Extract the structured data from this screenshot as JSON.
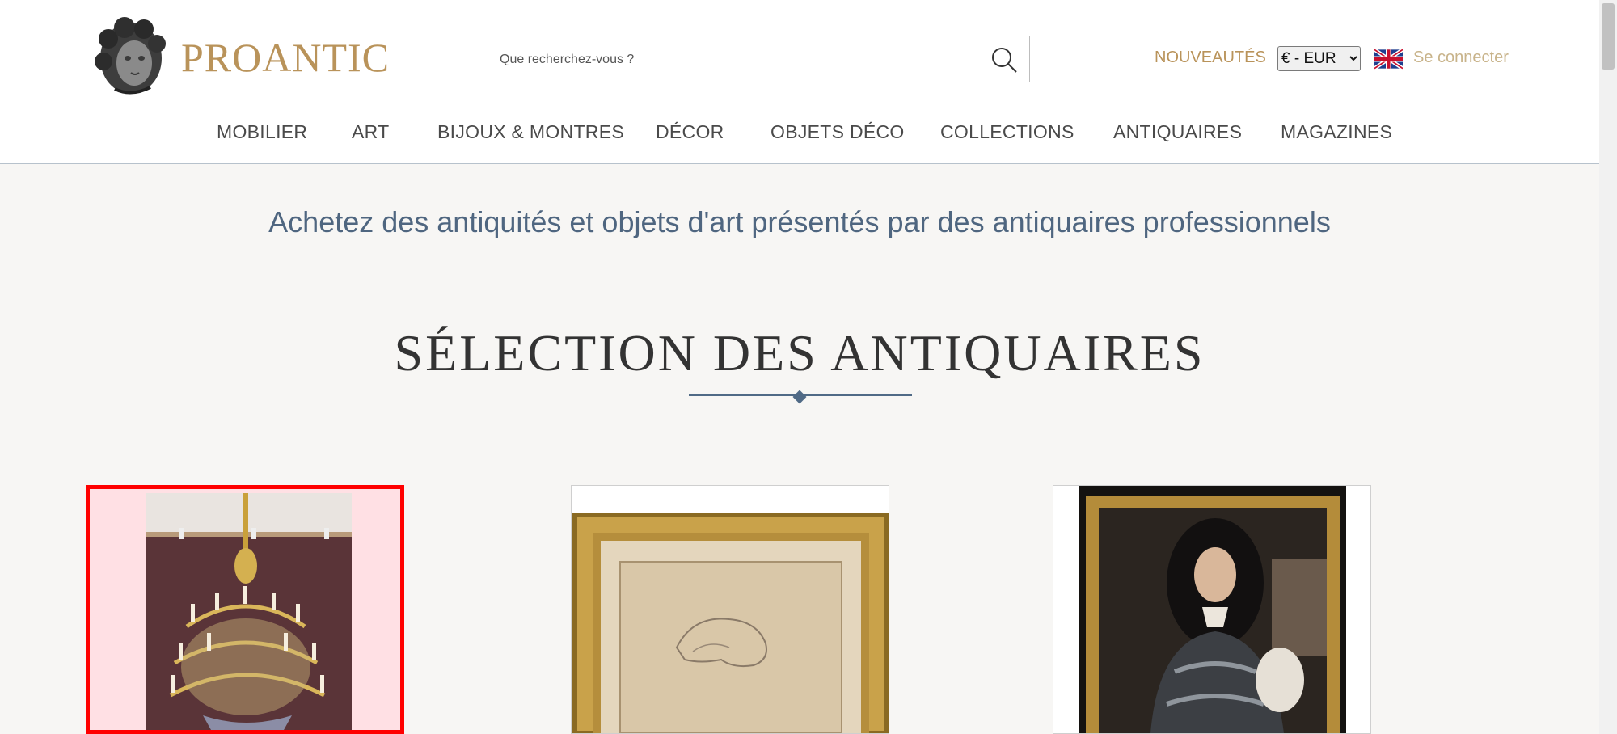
{
  "header": {
    "brand": "PROANTIC",
    "search_placeholder": "Que recherchez-vous ?",
    "new_label": "NOUVEAUTÉS",
    "currency_selected": "€ - EUR",
    "login_label": "Se connecter",
    "language_flag": "uk-flag-icon"
  },
  "nav": {
    "items": [
      {
        "label": "MOBILIER"
      },
      {
        "label": "ART"
      },
      {
        "label": "BIJOUX & MONTRES"
      },
      {
        "label": "DÉCOR"
      },
      {
        "label": "OBJETS DÉCO"
      },
      {
        "label": "COLLECTIONS"
      },
      {
        "label": "ANTIQUAIRES"
      },
      {
        "label": "MAGAZINES"
      }
    ]
  },
  "main": {
    "tagline": "Achetez des antiquités et objets d'art présentés par des antiquaires professionnels",
    "section_title": "SÉLECTION DES ANTIQUAIRES",
    "cards": [
      {
        "image": "chandelier-photo",
        "highlighted": true
      },
      {
        "image": "framed-drawing-photo",
        "highlighted": false
      },
      {
        "image": "portrait-in-armor-photo",
        "highlighted": false
      }
    ]
  },
  "colors": {
    "brand_gold": "#b9935a",
    "tagline_blue": "#4f6680",
    "highlight_red": "#ff0000",
    "page_background": "#f7f6f4"
  }
}
